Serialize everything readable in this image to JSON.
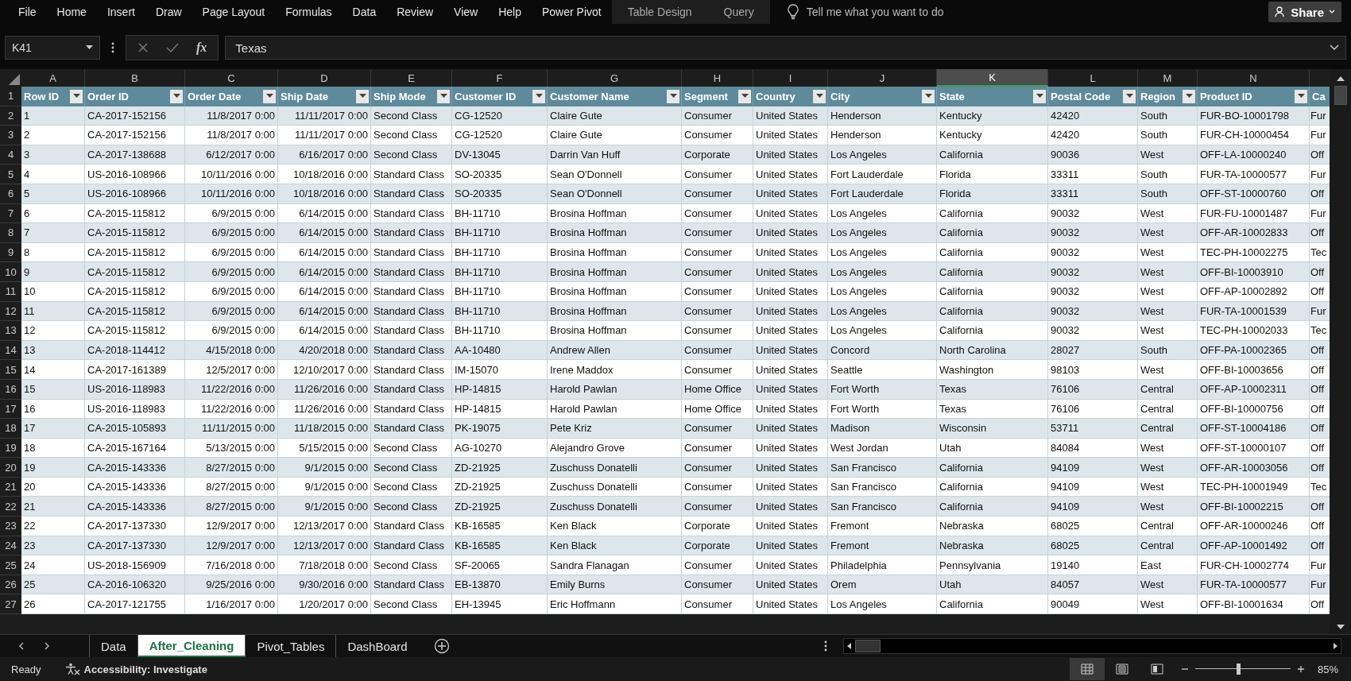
{
  "ribbon": {
    "tabs": [
      {
        "label": "File",
        "contextual": false
      },
      {
        "label": "Home",
        "contextual": false
      },
      {
        "label": "Insert",
        "contextual": false
      },
      {
        "label": "Draw",
        "contextual": false
      },
      {
        "label": "Page Layout",
        "contextual": false
      },
      {
        "label": "Formulas",
        "contextual": false
      },
      {
        "label": "Data",
        "contextual": false
      },
      {
        "label": "Review",
        "contextual": false
      },
      {
        "label": "View",
        "contextual": false
      },
      {
        "label": "Help",
        "contextual": false
      },
      {
        "label": "Power Pivot",
        "contextual": false
      },
      {
        "label": "Table Design",
        "contextual": true
      },
      {
        "label": "Query",
        "contextual": true
      }
    ],
    "tell_me": "Tell me what you want to do",
    "share_button": "Share"
  },
  "formula_bar": {
    "name_box": "K41",
    "function_button": "fx",
    "formula": "Texas"
  },
  "sheet": {
    "column_letters": [
      {
        "label": "A",
        "selected": false
      },
      {
        "label": "B",
        "selected": false
      },
      {
        "label": "C",
        "selected": false
      },
      {
        "label": "D",
        "selected": false
      },
      {
        "label": "E",
        "selected": false
      },
      {
        "label": "F",
        "selected": false
      },
      {
        "label": "G",
        "selected": false
      },
      {
        "label": "H",
        "selected": false
      },
      {
        "label": "I",
        "selected": false
      },
      {
        "label": "J",
        "selected": false
      },
      {
        "label": "K",
        "selected": true
      },
      {
        "label": "L",
        "selected": false
      },
      {
        "label": "M",
        "selected": false
      },
      {
        "label": "N",
        "selected": false
      }
    ],
    "table": {
      "header_row_number": "1",
      "columns": [
        {
          "label": "Row ID",
          "kind": "plain"
        },
        {
          "label": "Order ID",
          "kind": "plain"
        },
        {
          "label": "Order Date",
          "kind": "date"
        },
        {
          "label": "Ship Date",
          "kind": "date"
        },
        {
          "label": "Ship Mode",
          "kind": "plain"
        },
        {
          "label": "Customer ID",
          "kind": "plain"
        },
        {
          "label": "Customer Name",
          "kind": "plain"
        },
        {
          "label": "Segment",
          "kind": "plain"
        },
        {
          "label": "Country",
          "kind": "plain"
        },
        {
          "label": "City",
          "kind": "plain"
        },
        {
          "label": "State",
          "kind": "plain"
        },
        {
          "label": "Postal Code",
          "kind": "plain"
        },
        {
          "label": "Region",
          "kind": "plain"
        },
        {
          "label": "Product ID",
          "kind": "plain"
        },
        {
          "label": "Ca",
          "kind": "cut"
        }
      ],
      "rows": [
        {
          "number": "2",
          "cells": [
            "1",
            "CA-2017-152156",
            "11/8/2017 0:00",
            "11/11/2017 0:00",
            "Second Class",
            "CG-12520",
            "Claire Gute",
            "Consumer",
            "United States",
            "Henderson",
            "Kentucky",
            "42420",
            "South",
            "FUR-BO-10001798",
            "Fur"
          ]
        },
        {
          "number": "3",
          "cells": [
            "2",
            "CA-2017-152156",
            "11/8/2017 0:00",
            "11/11/2017 0:00",
            "Second Class",
            "CG-12520",
            "Claire Gute",
            "Consumer",
            "United States",
            "Henderson",
            "Kentucky",
            "42420",
            "South",
            "FUR-CH-10000454",
            "Fur"
          ]
        },
        {
          "number": "4",
          "cells": [
            "3",
            "CA-2017-138688",
            "6/12/2017 0:00",
            "6/16/2017 0:00",
            "Second Class",
            "DV-13045",
            "Darrin Van Huff",
            "Corporate",
            "United States",
            "Los Angeles",
            "California",
            "90036",
            "West",
            "OFF-LA-10000240",
            "Off"
          ]
        },
        {
          "number": "5",
          "cells": [
            "4",
            "US-2016-108966",
            "10/11/2016 0:00",
            "10/18/2016 0:00",
            "Standard Class",
            "SO-20335",
            "Sean O'Donnell",
            "Consumer",
            "United States",
            "Fort Lauderdale",
            "Florida",
            "33311",
            "South",
            "FUR-TA-10000577",
            "Fur"
          ]
        },
        {
          "number": "6",
          "cells": [
            "5",
            "US-2016-108966",
            "10/11/2016 0:00",
            "10/18/2016 0:00",
            "Standard Class",
            "SO-20335",
            "Sean O'Donnell",
            "Consumer",
            "United States",
            "Fort Lauderdale",
            "Florida",
            "33311",
            "South",
            "OFF-ST-10000760",
            "Off"
          ]
        },
        {
          "number": "7",
          "cells": [
            "6",
            "CA-2015-115812",
            "6/9/2015 0:00",
            "6/14/2015 0:00",
            "Standard Class",
            "BH-11710",
            "Brosina Hoffman",
            "Consumer",
            "United States",
            "Los Angeles",
            "California",
            "90032",
            "West",
            "FUR-FU-10001487",
            "Fur"
          ]
        },
        {
          "number": "8",
          "cells": [
            "7",
            "CA-2015-115812",
            "6/9/2015 0:00",
            "6/14/2015 0:00",
            "Standard Class",
            "BH-11710",
            "Brosina Hoffman",
            "Consumer",
            "United States",
            "Los Angeles",
            "California",
            "90032",
            "West",
            "OFF-AR-10002833",
            "Off"
          ]
        },
        {
          "number": "9",
          "cells": [
            "8",
            "CA-2015-115812",
            "6/9/2015 0:00",
            "6/14/2015 0:00",
            "Standard Class",
            "BH-11710",
            "Brosina Hoffman",
            "Consumer",
            "United States",
            "Los Angeles",
            "California",
            "90032",
            "West",
            "TEC-PH-10002275",
            "Tec"
          ]
        },
        {
          "number": "10",
          "cells": [
            "9",
            "CA-2015-115812",
            "6/9/2015 0:00",
            "6/14/2015 0:00",
            "Standard Class",
            "BH-11710",
            "Brosina Hoffman",
            "Consumer",
            "United States",
            "Los Angeles",
            "California",
            "90032",
            "West",
            "OFF-BI-10003910",
            "Off"
          ]
        },
        {
          "number": "11",
          "cells": [
            "10",
            "CA-2015-115812",
            "6/9/2015 0:00",
            "6/14/2015 0:00",
            "Standard Class",
            "BH-11710",
            "Brosina Hoffman",
            "Consumer",
            "United States",
            "Los Angeles",
            "California",
            "90032",
            "West",
            "OFF-AP-10002892",
            "Off"
          ]
        },
        {
          "number": "12",
          "cells": [
            "11",
            "CA-2015-115812",
            "6/9/2015 0:00",
            "6/14/2015 0:00",
            "Standard Class",
            "BH-11710",
            "Brosina Hoffman",
            "Consumer",
            "United States",
            "Los Angeles",
            "California",
            "90032",
            "West",
            "FUR-TA-10001539",
            "Fur"
          ]
        },
        {
          "number": "13",
          "cells": [
            "12",
            "CA-2015-115812",
            "6/9/2015 0:00",
            "6/14/2015 0:00",
            "Standard Class",
            "BH-11710",
            "Brosina Hoffman",
            "Consumer",
            "United States",
            "Los Angeles",
            "California",
            "90032",
            "West",
            "TEC-PH-10002033",
            "Tec"
          ]
        },
        {
          "number": "14",
          "cells": [
            "13",
            "CA-2018-114412",
            "4/15/2018 0:00",
            "4/20/2018 0:00",
            "Standard Class",
            "AA-10480",
            "Andrew Allen",
            "Consumer",
            "United States",
            "Concord",
            "North Carolina",
            "28027",
            "South",
            "OFF-PA-10002365",
            "Off"
          ]
        },
        {
          "number": "15",
          "cells": [
            "14",
            "CA-2017-161389",
            "12/5/2017 0:00",
            "12/10/2017 0:00",
            "Standard Class",
            "IM-15070",
            "Irene Maddox",
            "Consumer",
            "United States",
            "Seattle",
            "Washington",
            "98103",
            "West",
            "OFF-BI-10003656",
            "Off"
          ]
        },
        {
          "number": "16",
          "cells": [
            "15",
            "US-2016-118983",
            "11/22/2016 0:00",
            "11/26/2016 0:00",
            "Standard Class",
            "HP-14815",
            "Harold Pawlan",
            "Home Office",
            "United States",
            "Fort Worth",
            "Texas",
            "76106",
            "Central",
            "OFF-AP-10002311",
            "Off"
          ]
        },
        {
          "number": "17",
          "cells": [
            "16",
            "US-2016-118983",
            "11/22/2016 0:00",
            "11/26/2016 0:00",
            "Standard Class",
            "HP-14815",
            "Harold Pawlan",
            "Home Office",
            "United States",
            "Fort Worth",
            "Texas",
            "76106",
            "Central",
            "OFF-BI-10000756",
            "Off"
          ]
        },
        {
          "number": "18",
          "cells": [
            "17",
            "CA-2015-105893",
            "11/11/2015 0:00",
            "11/18/2015 0:00",
            "Standard Class",
            "PK-19075",
            "Pete Kriz",
            "Consumer",
            "United States",
            "Madison",
            "Wisconsin",
            "53711",
            "Central",
            "OFF-ST-10004186",
            "Off"
          ]
        },
        {
          "number": "19",
          "cells": [
            "18",
            "CA-2015-167164",
            "5/13/2015 0:00",
            "5/15/2015 0:00",
            "Second Class",
            "AG-10270",
            "Alejandro Grove",
            "Consumer",
            "United States",
            "West Jordan",
            "Utah",
            "84084",
            "West",
            "OFF-ST-10000107",
            "Off"
          ]
        },
        {
          "number": "20",
          "cells": [
            "19",
            "CA-2015-143336",
            "8/27/2015 0:00",
            "9/1/2015 0:00",
            "Second Class",
            "ZD-21925",
            "Zuschuss Donatelli",
            "Consumer",
            "United States",
            "San Francisco",
            "California",
            "94109",
            "West",
            "OFF-AR-10003056",
            "Off"
          ]
        },
        {
          "number": "21",
          "cells": [
            "20",
            "CA-2015-143336",
            "8/27/2015 0:00",
            "9/1/2015 0:00",
            "Second Class",
            "ZD-21925",
            "Zuschuss Donatelli",
            "Consumer",
            "United States",
            "San Francisco",
            "California",
            "94109",
            "West",
            "TEC-PH-10001949",
            "Tec"
          ]
        },
        {
          "number": "22",
          "cells": [
            "21",
            "CA-2015-143336",
            "8/27/2015 0:00",
            "9/1/2015 0:00",
            "Second Class",
            "ZD-21925",
            "Zuschuss Donatelli",
            "Consumer",
            "United States",
            "San Francisco",
            "California",
            "94109",
            "West",
            "OFF-BI-10002215",
            "Off"
          ]
        },
        {
          "number": "23",
          "cells": [
            "22",
            "CA-2017-137330",
            "12/9/2017 0:00",
            "12/13/2017 0:00",
            "Standard Class",
            "KB-16585",
            "Ken Black",
            "Corporate",
            "United States",
            "Fremont",
            "Nebraska",
            "68025",
            "Central",
            "OFF-AR-10000246",
            "Off"
          ]
        },
        {
          "number": "24",
          "cells": [
            "23",
            "CA-2017-137330",
            "12/9/2017 0:00",
            "12/13/2017 0:00",
            "Standard Class",
            "KB-16585",
            "Ken Black",
            "Corporate",
            "United States",
            "Fremont",
            "Nebraska",
            "68025",
            "Central",
            "OFF-AP-10001492",
            "Off"
          ]
        },
        {
          "number": "25",
          "cells": [
            "24",
            "US-2018-156909",
            "7/16/2018 0:00",
            "7/18/2018 0:00",
            "Second Class",
            "SF-20065",
            "Sandra Flanagan",
            "Consumer",
            "United States",
            "Philadelphia",
            "Pennsylvania",
            "19140",
            "East",
            "FUR-CH-10002774",
            "Fur"
          ]
        },
        {
          "number": "26",
          "cells": [
            "25",
            "CA-2016-106320",
            "9/25/2016 0:00",
            "9/30/2016 0:00",
            "Standard Class",
            "EB-13870",
            "Emily Burns",
            "Consumer",
            "United States",
            "Orem",
            "Utah",
            "84057",
            "West",
            "FUR-TA-10000577",
            "Fur"
          ]
        },
        {
          "number": "27",
          "cells": [
            "26",
            "CA-2017-121755",
            "1/16/2017 0:00",
            "1/20/2017 0:00",
            "Second Class",
            "EH-13945",
            "Eric Hoffmann",
            "Consumer",
            "United States",
            "Los Angeles",
            "California",
            "90049",
            "West",
            "OFF-BI-10001634",
            "Off"
          ]
        }
      ]
    }
  },
  "sheet_tabs": [
    {
      "label": "Data",
      "selected": false
    },
    {
      "label": "After_Cleaning",
      "selected": true
    },
    {
      "label": "Pivot_Tables",
      "selected": false
    },
    {
      "label": "DashBoard",
      "selected": false
    }
  ],
  "status_bar": {
    "status": "Ready",
    "accessibility": "Accessibility: Investigate",
    "views": [
      {
        "kind": "normal",
        "selected": true
      },
      {
        "kind": "page_layout",
        "selected": false
      },
      {
        "kind": "page_break",
        "selected": false
      }
    ],
    "zoom": {
      "level": 0.45,
      "reading": "85%"
    }
  }
}
